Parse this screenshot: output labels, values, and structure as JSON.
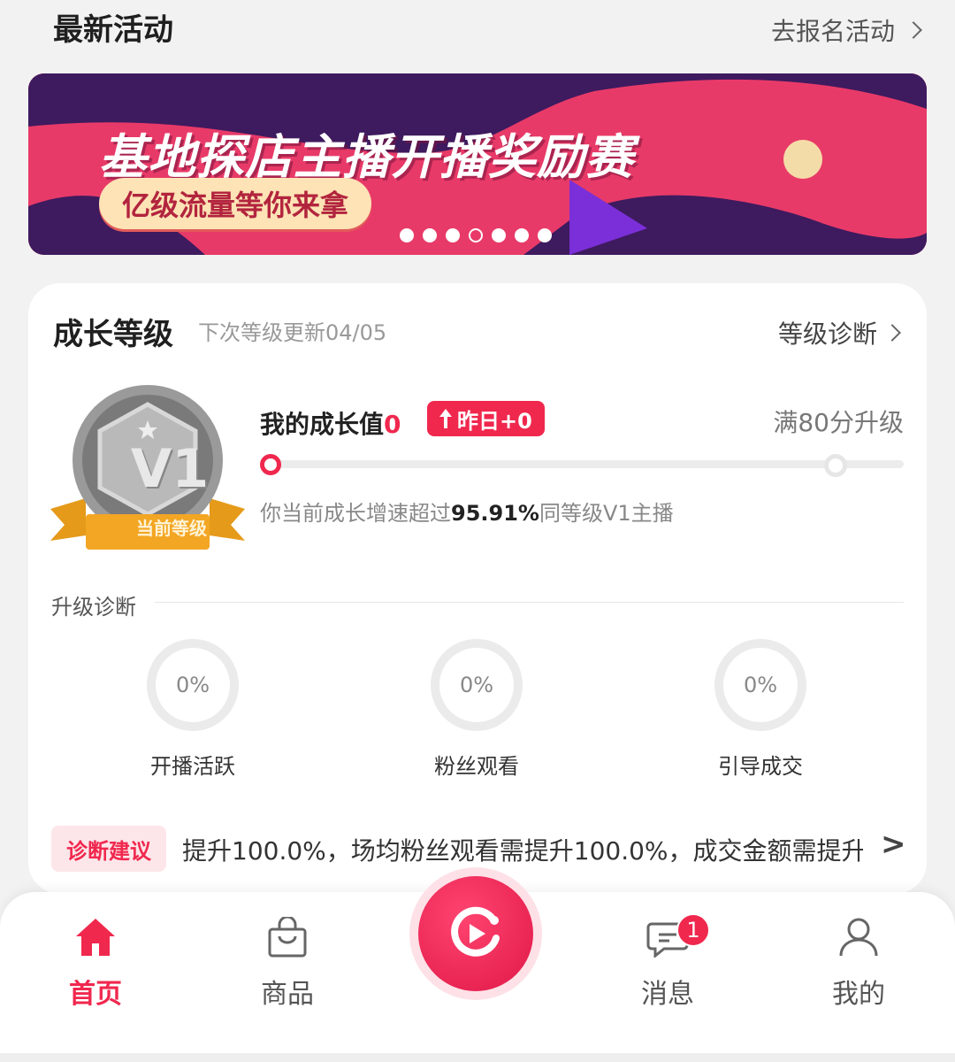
{
  "activities": {
    "title": "最新活动",
    "link_label": "去报名活动"
  },
  "banner": {
    "title": "基地探店主播开播奖励赛",
    "pill": "亿级流量等你来拿",
    "dots_total": 7,
    "dots_active_index": 3
  },
  "growth": {
    "title": "成长等级",
    "next_update": "下次等级更新04/05",
    "diagnose_link": "等级诊断",
    "badge_level": "V1",
    "badge_label": "当前等级",
    "value_label": "我的成长值",
    "value": "0",
    "yesterday": "昨日+0",
    "upgrade_text": "满80分升级",
    "progress": 0,
    "speed_prefix": "你当前成长增速超过",
    "speed_percent": "95.91%",
    "speed_suffix": "同等级V1主播"
  },
  "diagnosis": {
    "title": "升级诊断",
    "metrics": [
      {
        "label": "开播活跃",
        "value": "0%"
      },
      {
        "label": "粉丝观看",
        "value": "0%"
      },
      {
        "label": "引导成交",
        "value": "0%"
      }
    ],
    "advice_tag": "诊断建议",
    "advice_text": "提升100.0%，场均粉丝观看需提升100.0%，成交金额需提升",
    "advice_arrow": ">"
  },
  "tabbar": {
    "home": "首页",
    "products": "商品",
    "messages": "消息",
    "messages_badge": "1",
    "me": "我的"
  },
  "colors": {
    "accent": "#f0284e",
    "banner_purple": "#3e1a5f",
    "banner_pink": "#e83a68"
  }
}
